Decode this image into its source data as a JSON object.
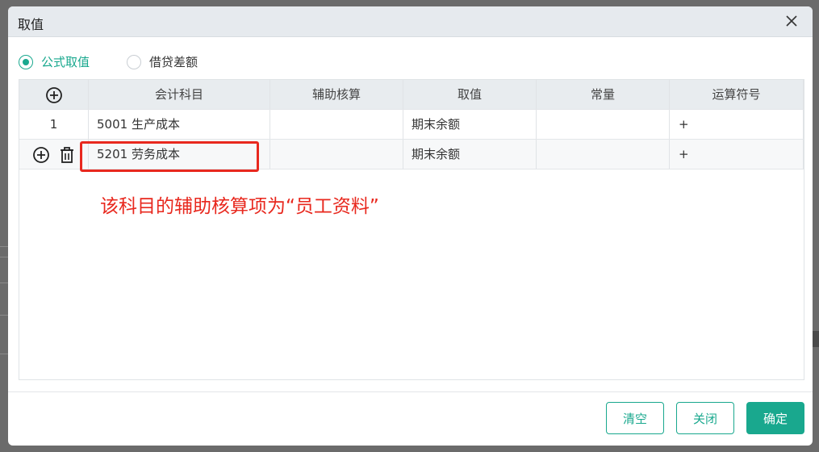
{
  "dialog": {
    "title": "取值"
  },
  "radios": [
    {
      "label": "公式取值",
      "checked": true
    },
    {
      "label": "借贷差额",
      "checked": false
    }
  ],
  "table": {
    "headers": [
      "会计科目",
      "辅助核算",
      "取值",
      "常量",
      "运算符号"
    ],
    "rows": [
      {
        "index": "1",
        "account": "5001 生产成本",
        "auxiliary": "",
        "value": "期末余额",
        "constant": "",
        "operator": "+"
      },
      {
        "index": "",
        "account": "5201 劳务成本",
        "auxiliary": "",
        "value": "期末余额",
        "constant": "",
        "operator": "+"
      }
    ]
  },
  "annotation": {
    "text": "该科目的辅助核算项为“员工资料”",
    "color": "#e8281e"
  },
  "buttons": {
    "clear": "清空",
    "close": "关闭",
    "confirm": "确定"
  },
  "colors": {
    "accent": "#19a88e",
    "annotation": "#e8281e",
    "header_bg": "#e6eaee"
  },
  "icons": {
    "add": "plus-circle-icon",
    "delete": "trash-icon",
    "close": "close-icon"
  }
}
